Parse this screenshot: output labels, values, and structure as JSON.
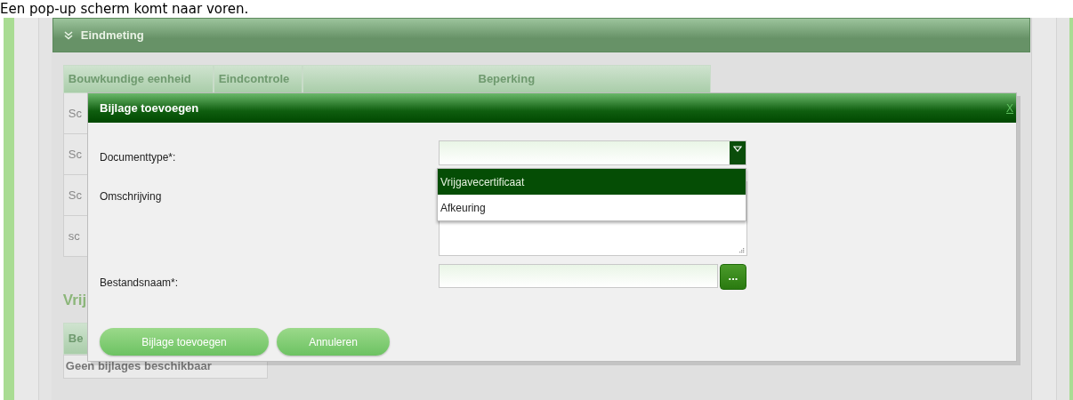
{
  "caption": "Een pop-up scherm komt naar voren.",
  "section": {
    "title": "Eindmeting",
    "expanded": true
  },
  "table": {
    "columns": [
      "Bouwkundige eenheid",
      "Eindcontrole",
      "Beperking"
    ],
    "rows": [
      "Sc",
      "Sc",
      "Sc",
      "sc"
    ]
  },
  "attachments": {
    "heading": "Vrij",
    "columns": [
      "Be"
    ],
    "empty_text": "Geen bijlages beschikbaar"
  },
  "dialog": {
    "title": "Bijlage toevoegen",
    "close": "X",
    "fields": [
      {
        "kind": "select",
        "label": "Documenttype*:",
        "expanded": true,
        "options": [
          {
            "label": "Vrijgavecertificaat",
            "selected": true
          },
          {
            "label": "Afkeuring",
            "selected": false
          }
        ]
      },
      {
        "kind": "textarea",
        "label": "Omschrijving"
      },
      {
        "kind": "file",
        "label": "Bestandsnaam*:",
        "browse": "..."
      }
    ],
    "buttons": [
      "Bijlage toevoegen",
      "Annuleren"
    ]
  }
}
